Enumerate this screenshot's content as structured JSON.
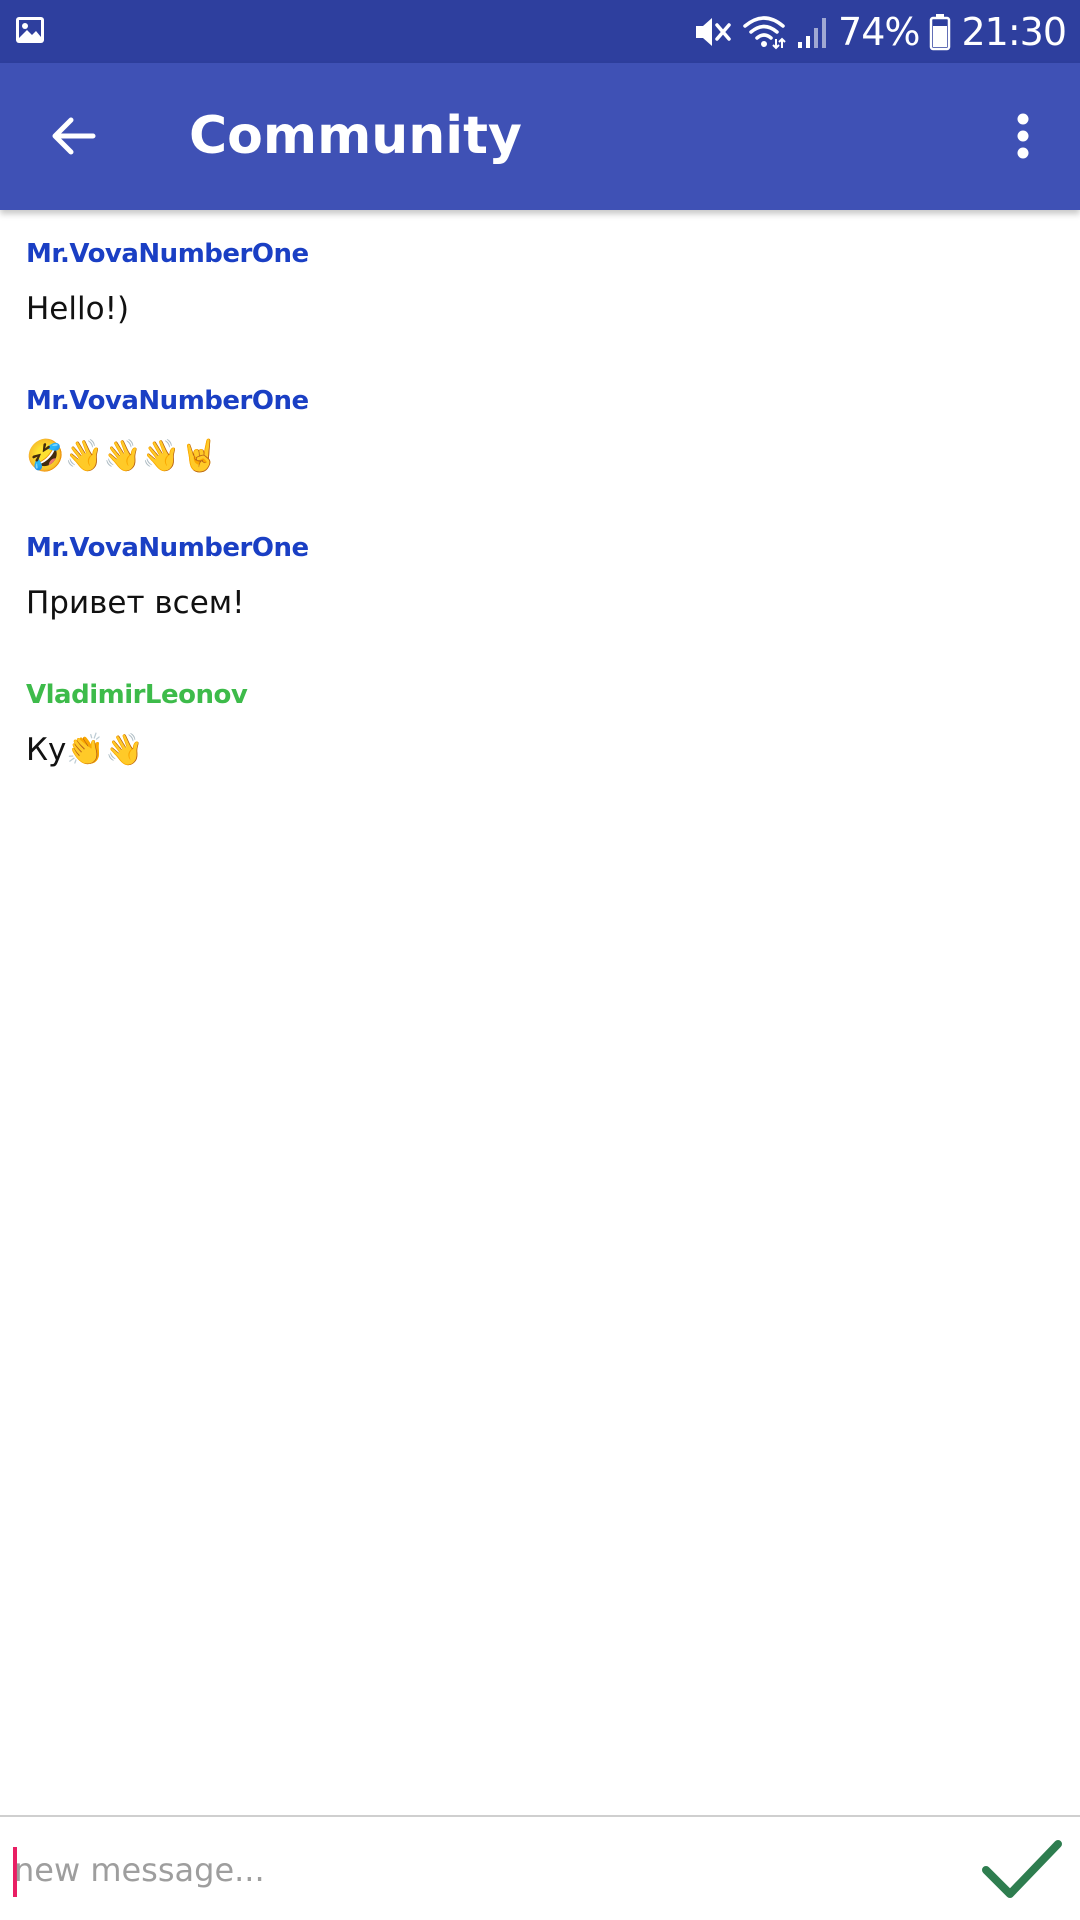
{
  "status_bar": {
    "left_icon": "gallery-notification-icon",
    "icons": [
      "mute-icon",
      "wifi-icon",
      "signal-icon"
    ],
    "battery_percent": "74%",
    "battery_level": 0.74,
    "time": "21:30",
    "background": "#2e3f9e"
  },
  "app_bar": {
    "back_icon": "arrow-back-icon",
    "title": "Community",
    "menu_icon": "more-vert-icon",
    "background": "#3f51b5"
  },
  "messages": [
    {
      "author": "Mr.VovaNumberOne",
      "author_color": "#1a3fc4",
      "text": "Hello!)"
    },
    {
      "author": "Mr.VovaNumberOne",
      "author_color": "#1a3fc4",
      "text": "🤣👋👋👋🤘"
    },
    {
      "author": "Mr.VovaNumberOne",
      "author_color": "#1a3fc4",
      "text": "Привет всем!"
    },
    {
      "author": "VladimirLeonov",
      "author_color": "#3dbb4a",
      "text": "Ку👏👋"
    }
  ],
  "composer": {
    "value": "",
    "placeholder": "new message...",
    "send_icon": "checkmark-send-icon",
    "send_color": "#2e7d4f"
  }
}
